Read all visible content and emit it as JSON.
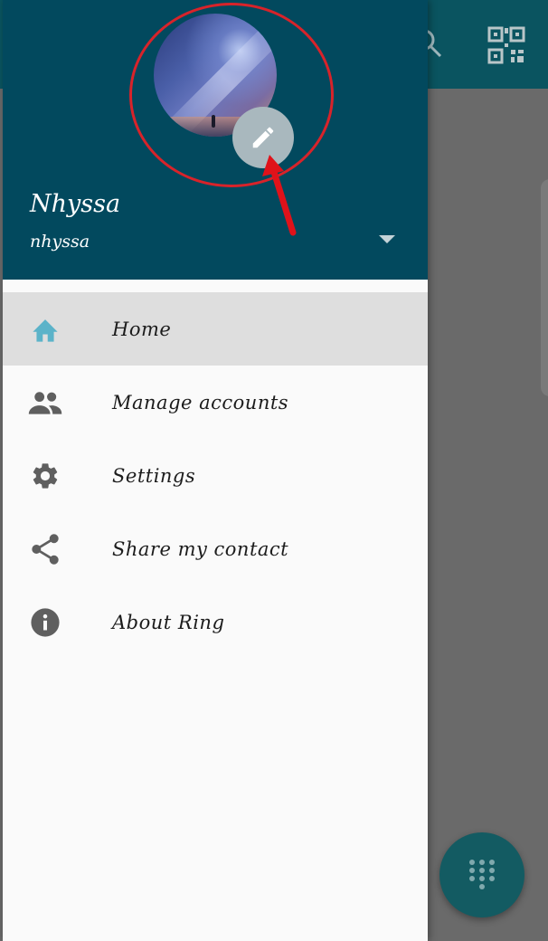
{
  "header": {
    "user_name": "Nhyssa",
    "user_handle": "nhyssa",
    "avatar_icon": "avatar-photo",
    "edit_icon": "pencil-icon",
    "dropdown_icon": "caret-down-icon"
  },
  "menu": {
    "items": [
      {
        "label": "Home",
        "icon": "home-icon",
        "active": true
      },
      {
        "label": "Manage accounts",
        "icon": "people-icon",
        "active": false
      },
      {
        "label": "Settings",
        "icon": "gear-icon",
        "active": false
      },
      {
        "label": "Share my contact",
        "icon": "share-icon",
        "active": false
      },
      {
        "label": "About Ring",
        "icon": "info-icon",
        "active": false
      }
    ]
  },
  "background_app": {
    "toolbar_icons": [
      "search-icon",
      "qr-code-icon"
    ],
    "fab_icon": "dialpad-icon"
  },
  "colors": {
    "header_bg": "#02495e",
    "accent_home": "#5bb3c9",
    "fab_bg": "#135b62",
    "annotation": "#d8232a"
  }
}
